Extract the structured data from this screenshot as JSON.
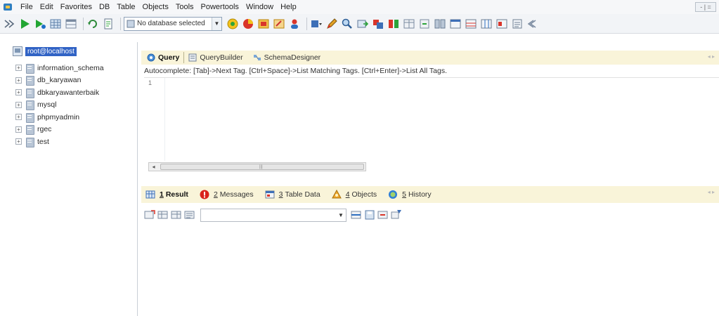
{
  "menubar": {
    "items": [
      "File",
      "Edit",
      "Favorites",
      "DB",
      "Table",
      "Objects",
      "Tools",
      "Powertools",
      "Window",
      "Help"
    ],
    "window_controls": "- | ="
  },
  "toolbar": {
    "db_select": "No database selected"
  },
  "tree": {
    "root": "root@localhost",
    "databases": [
      {
        "name": "information_schema"
      },
      {
        "name": "db_karyawan"
      },
      {
        "name": "dbkaryawanterbaik"
      },
      {
        "name": "mysql"
      },
      {
        "name": "phpmyadmin"
      },
      {
        "name": "rgec"
      },
      {
        "name": "test"
      }
    ],
    "expander_glyph": "+"
  },
  "query": {
    "tabs": [
      {
        "label": "Query"
      },
      {
        "label": "QueryBuilder"
      },
      {
        "label": "SchemaDesigner"
      }
    ],
    "autocomplete_hint": "Autocomplete: [Tab]->Next Tag. [Ctrl+Space]->List Matching Tags. [Ctrl+Enter]->List All Tags.",
    "line_number": "1"
  },
  "results": {
    "tabs": [
      {
        "num": "1",
        "label": "Result"
      },
      {
        "num": "2",
        "label": "Messages"
      },
      {
        "num": "3",
        "label": "Table Data"
      },
      {
        "num": "4",
        "label": "Objects"
      },
      {
        "num": "5",
        "label": "History"
      }
    ]
  },
  "colors": {
    "tab_strip": "#f9f4d9",
    "selection": "#3163c5",
    "accent_green": "#2da43a"
  }
}
